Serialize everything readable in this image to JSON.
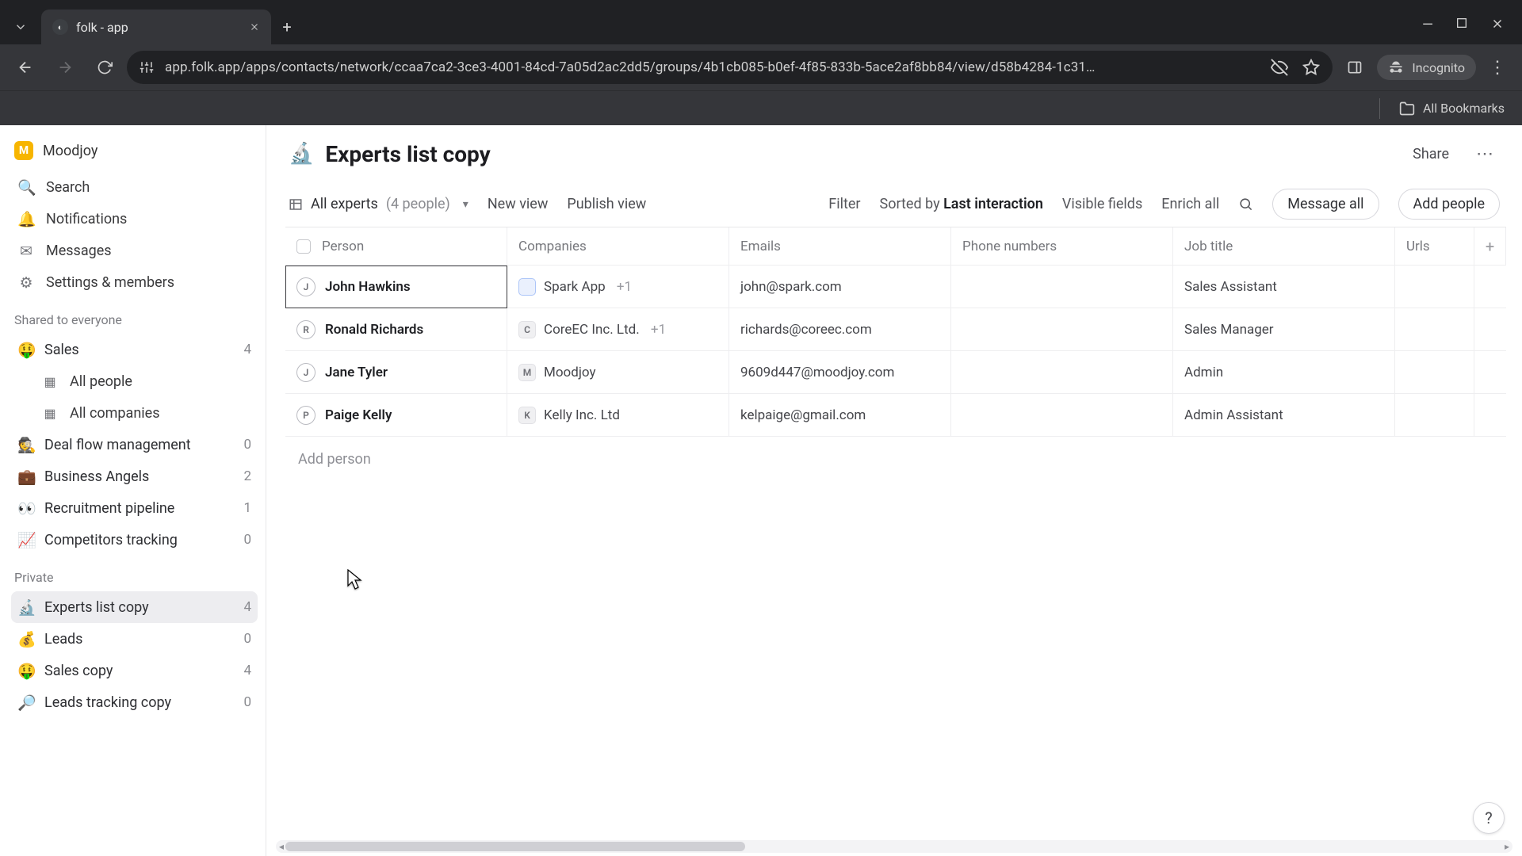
{
  "browser": {
    "tab_title": "folk - app",
    "url": "app.folk.app/apps/contacts/network/ccaa7ca2-3ce3-4001-84cd-7a05d2ac2dd5/groups/4b1cb085-b0ef-4f85-833b-5ace2af8bb84/view/d58b4284-1c31…",
    "incognito_label": "Incognito",
    "all_bookmarks": "All Bookmarks"
  },
  "workspace": {
    "initial": "M",
    "name": "Moodjoy"
  },
  "sidebar": {
    "nav": [
      {
        "icon": "🔍",
        "label": "Search"
      },
      {
        "icon": "🔔",
        "label": "Notifications"
      },
      {
        "icon": "✉",
        "label": "Messages"
      },
      {
        "icon": "⚙",
        "label": "Settings & members"
      }
    ],
    "shared_label": "Shared to everyone",
    "shared": [
      {
        "emoji": "🤑",
        "label": "Sales",
        "count": "4",
        "children": [
          {
            "icon": "▦",
            "label": "All people"
          },
          {
            "icon": "▦",
            "label": "All companies"
          }
        ]
      },
      {
        "emoji": "🕵️",
        "label": "Deal flow management",
        "count": "0"
      },
      {
        "emoji": "💼",
        "label": "Business Angels",
        "count": "2"
      },
      {
        "emoji": "👀",
        "label": "Recruitment pipeline",
        "count": "1"
      },
      {
        "emoji": "📈",
        "label": "Competitors tracking",
        "count": "0"
      }
    ],
    "private_label": "Private",
    "private": [
      {
        "emoji": "🔬",
        "label": "Experts list copy",
        "count": "4",
        "active": true
      },
      {
        "emoji": "💰",
        "label": "Leads",
        "count": "0"
      },
      {
        "emoji": "🤑",
        "label": "Sales copy",
        "count": "4"
      },
      {
        "emoji": "🔎",
        "label": "Leads tracking copy",
        "count": "0"
      }
    ]
  },
  "page": {
    "emoji": "🔬",
    "title": "Experts list copy",
    "share": "Share"
  },
  "toolbar": {
    "view_name": "All experts",
    "view_count": "(4 people)",
    "new_view": "New view",
    "publish_view": "Publish view",
    "filter": "Filter",
    "sorted_prefix": "Sorted by ",
    "sorted_field": "Last interaction",
    "visible_fields": "Visible fields",
    "enrich_all": "Enrich all",
    "message_all": "Message all",
    "add_people": "Add people"
  },
  "table": {
    "headers": {
      "person": "Person",
      "companies": "Companies",
      "emails": "Emails",
      "phone": "Phone numbers",
      "job": "Job title",
      "urls": "Urls"
    },
    "rows": [
      {
        "initial": "J",
        "name": "John Hawkins",
        "co_badge": "",
        "co_badge_class": "blue",
        "company": "Spark App",
        "extra": "+1",
        "email": "john@spark.com",
        "phone": "",
        "job": "Sales Assistant",
        "selected": true
      },
      {
        "initial": "R",
        "name": "Ronald Richards",
        "co_badge": "C",
        "co_badge_class": "gray",
        "company": "CoreEC Inc. Ltd.",
        "extra": "+1",
        "email": "richards@coreec.com",
        "phone": "",
        "job": "Sales Manager"
      },
      {
        "initial": "J",
        "name": "Jane Tyler",
        "co_badge": "M",
        "co_badge_class": "gray",
        "company": "Moodjoy",
        "extra": "",
        "email": "9609d447@moodjoy.com",
        "phone": "",
        "job": "Admin"
      },
      {
        "initial": "P",
        "name": "Paige Kelly",
        "co_badge": "K",
        "co_badge_class": "gray",
        "company": "Kelly Inc. Ltd",
        "extra": "",
        "email": "kelpaige@gmail.com",
        "phone": "",
        "job": "Admin Assistant"
      }
    ],
    "add_person": "Add person"
  }
}
